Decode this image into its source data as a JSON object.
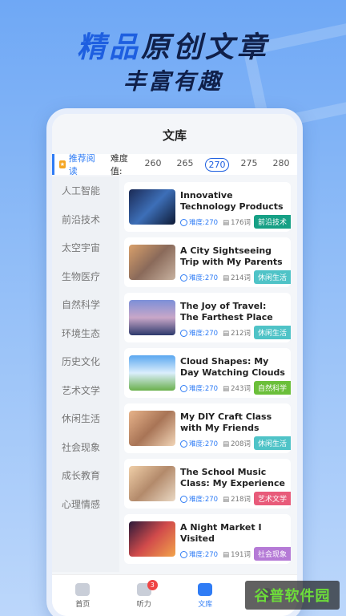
{
  "headline": {
    "part1": "精品",
    "part2": "原创文章"
  },
  "subline": "丰富有趣",
  "header": {
    "title": "文库"
  },
  "filter": {
    "recommend": "推荐阅读",
    "difficulty_label": "难度值:",
    "values": [
      "260",
      "265",
      "270",
      "275",
      "280"
    ],
    "active": "270"
  },
  "sidebar": {
    "items": [
      "人工智能",
      "前沿技术",
      "太空宇宙",
      "生物医疗",
      "自然科学",
      "环境生态",
      "历史文化",
      "艺术文学",
      "休闲生活",
      "社会现象",
      "成长教育",
      "心理情感"
    ]
  },
  "articles": [
    {
      "title": "Innovative Technology Products",
      "difficulty": "难度:270",
      "words": "176词",
      "tag": "前沿技术",
      "tag_color": "#16a085",
      "thumb": "linear-gradient(135deg,#1b2a55,#3d6fb8,#0e1a35)"
    },
    {
      "title": "A City Sightseeing Trip with My Parents",
      "difficulty": "难度:270",
      "words": "214词",
      "tag": "休闲生活",
      "tag_color": "#4fc3c7",
      "thumb": "linear-gradient(135deg,#d9a06b,#8a6a5a,#c8b2a0)"
    },
    {
      "title": "The Joy of Travel: The Farthest Place I've Been",
      "difficulty": "难度:270",
      "words": "212词",
      "tag": "休闲生活",
      "tag_color": "#4fc3c7",
      "thumb": "linear-gradient(180deg,#7c8fd8,#c9a7c8,#2d3a6c)"
    },
    {
      "title": "Cloud Shapes: My Day Watching Clouds in th...",
      "difficulty": "难度:270",
      "words": "243词",
      "tag": "自然科学",
      "tag_color": "#6bbf3a",
      "thumb": "linear-gradient(180deg,#5aa7f0,#dbeefc,#6ab04c)"
    },
    {
      "title": "My DIY Craft Class with My Friends",
      "difficulty": "难度:270",
      "words": "208词",
      "tag": "休闲生活",
      "tag_color": "#4fc3c7",
      "thumb": "linear-gradient(135deg,#e7b38a,#a87456,#f2d6b8)"
    },
    {
      "title": "The School Music Class: My Experience Learni...",
      "difficulty": "难度:270",
      "words": "218词",
      "tag": "艺术文学",
      "tag_color": "#e85b7a",
      "thumb": "linear-gradient(135deg,#f0cfa8,#b38a6b,#ead9c4)"
    },
    {
      "title": "A Night Market I Visited",
      "difficulty": "难度:270",
      "words": "191词",
      "tag": "社会现象",
      "tag_color": "#b57ad6",
      "thumb": "linear-gradient(135deg,#2b1a3a,#d14b4b,#f2a44b)"
    }
  ],
  "nav": [
    {
      "label": "首页",
      "icon": "home-icon"
    },
    {
      "label": "听力",
      "icon": "headphones-icon",
      "badge": "3"
    },
    {
      "label": "文库",
      "icon": "library-icon"
    },
    {
      "label": "",
      "icon": "profile-icon"
    }
  ],
  "watermark": "谷普软件园"
}
